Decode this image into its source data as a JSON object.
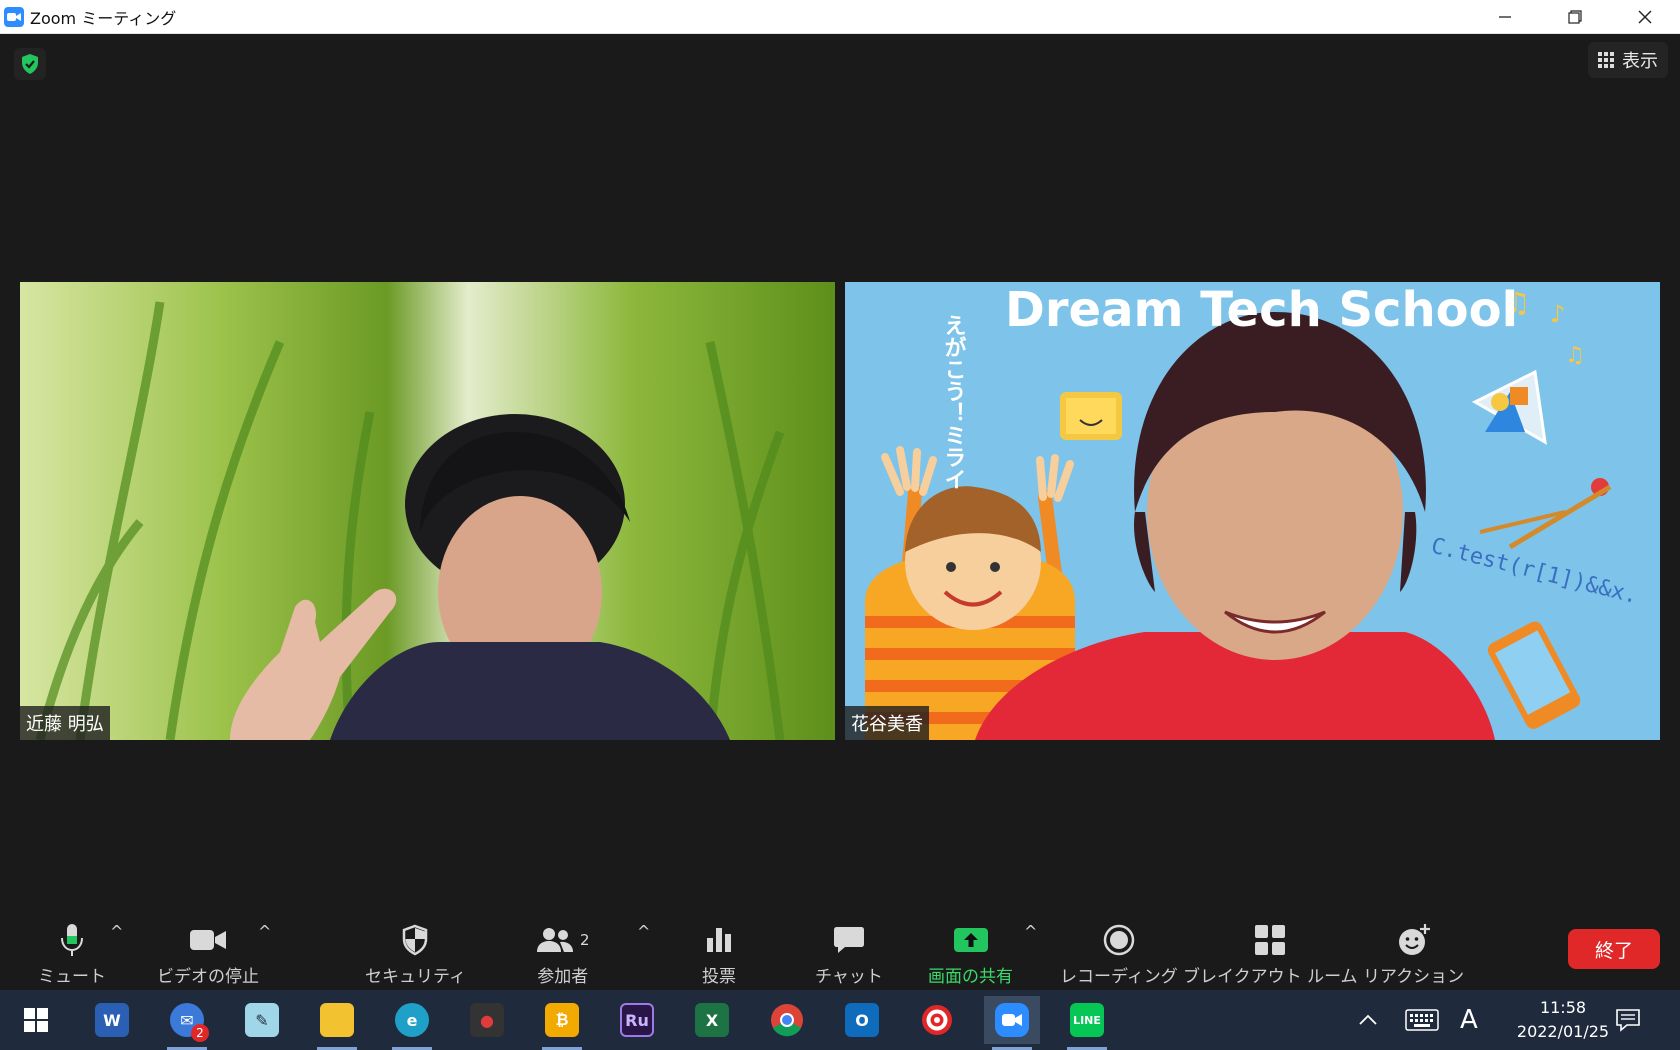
{
  "window": {
    "title": "Zoom ミーティング",
    "controls": [
      "minimize",
      "restore",
      "close"
    ]
  },
  "top_bar": {
    "view_label": "表示"
  },
  "participants": [
    {
      "name": "近藤 明弘"
    },
    {
      "name": "花谷美香",
      "background_text": "Dream Tech School",
      "vertical_text": "えがこう！ミライ",
      "code_text": "C.test(r[1])&&x."
    }
  ],
  "toolbar": {
    "mute_label": "ミュート",
    "video_label": "ビデオの停止",
    "security_label": "セキュリティ",
    "participants_label": "参加者",
    "participants_count": "2",
    "poll_label": "投票",
    "chat_label": "チャット",
    "share_label": "画面の共有",
    "record_label": "レコーディング",
    "breakout_label": "ブレイクアウト ルーム",
    "reaction_label": "リアクション",
    "end_label": "終了"
  },
  "taskbar": {
    "apps": [
      "start",
      "word",
      "mail",
      "notepad",
      "explorer",
      "edge",
      "screen-recorder",
      "bitcoin",
      "rush",
      "excel",
      "chrome",
      "outlook",
      "target",
      "zoom",
      "line"
    ],
    "mail_badge": "2",
    "ime_label": "A",
    "time": "11:58",
    "date": "2022/01/25"
  },
  "colors": {
    "accent_green": "#3bd96a",
    "end_red": "#e02828",
    "zoom_blue": "#2d8cff"
  }
}
